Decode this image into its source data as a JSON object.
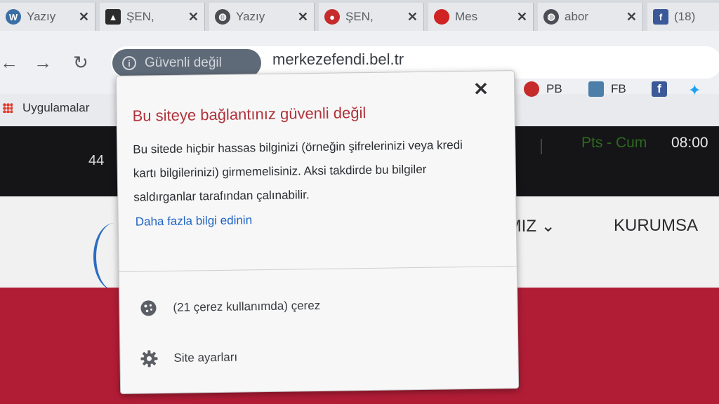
{
  "tabs": [
    {
      "title": "Yazıy",
      "icon": "wordpress-icon",
      "color": "#3a6ea5"
    },
    {
      "title": "ŞEN,",
      "icon": "person-silhouette-icon",
      "color": "#2b2b2b"
    },
    {
      "title": "Yazıy",
      "icon": "globe-icon",
      "color": "#4a4e54"
    },
    {
      "title": "ŞEN,",
      "icon": "helmet-icon",
      "color": "#c62b2b"
    },
    {
      "title": "Mes",
      "icon": "red-circle-icon",
      "color": "#d02323"
    },
    {
      "title": "abor",
      "icon": "globe-icon",
      "color": "#4a4e54"
    },
    {
      "title": "(18)",
      "icon": "facebook-icon",
      "color": "#3b5998"
    }
  ],
  "omnibox": {
    "security_chip": "Güvenli değil",
    "url": "merkezefendi.bel.tr"
  },
  "bookmarks": {
    "apps": "Uygulamalar",
    "items": [
      {
        "label": "PB",
        "icon": "helmet-icon"
      },
      {
        "label": "FB",
        "icon": "image-icon"
      },
      {
        "label": "",
        "icon": "facebook-icon"
      },
      {
        "label": "",
        "icon": "twitter-icon"
      }
    ]
  },
  "page_behind": {
    "dark_left": "44",
    "days": "Pts - Cum",
    "time": "08:00",
    "nav_1": "IMIZ ⌄",
    "nav_2": "KURUMSA"
  },
  "popup": {
    "title": "Bu siteye bağlantınız güvenli değil",
    "body": "Bu sitede hiçbir hassas bilginizi (örneğin şifrelerinizi veya kredi kartı bilgilerinizi) girmemelisiniz. Aksi takdirde bu bilgiler saldırganlar tarafından çalınabilir.",
    "link": "Daha fazla bilgi edinin",
    "cookies": "(21 çerez kullanımda) çerez",
    "site_settings": "Site ayarları",
    "close": "✕"
  },
  "colors": {
    "warning_red": "#b0323a",
    "link_blue": "#1e63c4",
    "brand_red": "#b21d36"
  }
}
